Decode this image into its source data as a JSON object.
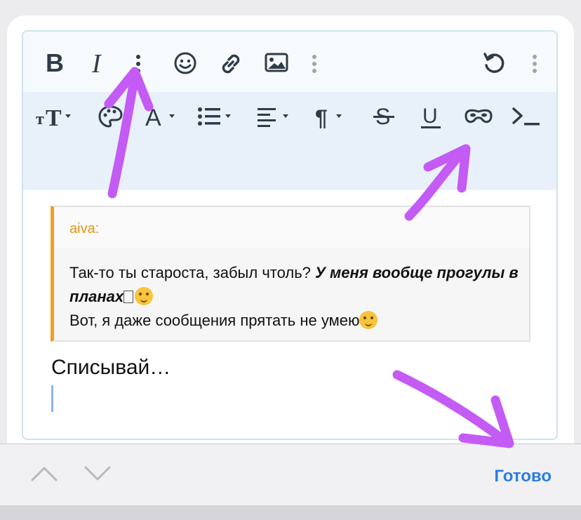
{
  "toolbar": {
    "bold_label": "B",
    "italic_label": "I",
    "icons_row1": [
      "bold-icon",
      "italic-icon",
      "more-vertical-icon",
      "smiley-icon",
      "link-icon",
      "image-icon",
      "more-vertical-icon",
      "undo-icon",
      "more-vertical-icon"
    ],
    "icons_row2": [
      "text-size-icon",
      "palette-icon",
      "font-color-icon",
      "list-icon",
      "align-icon",
      "paragraph-icon",
      "strikethrough-icon",
      "underline-icon",
      "spoiler-mask-icon",
      "code-terminal-icon"
    ]
  },
  "quote": {
    "author": "aiva:",
    "line1_plain": "Так-то ты староста, забыл чтоль? ",
    "line1_bold": "У меня вообще прогулы в планах",
    "line2": "Вот, я даже сообщения прятать не умею"
  },
  "editor": {
    "body_text": "Списывай…"
  },
  "bottom": {
    "done_label": "Готово"
  },
  "colors": {
    "accent": "#2a7de1",
    "quote_border": "#f0a023",
    "annotation_arrow": "#c45bf5"
  }
}
